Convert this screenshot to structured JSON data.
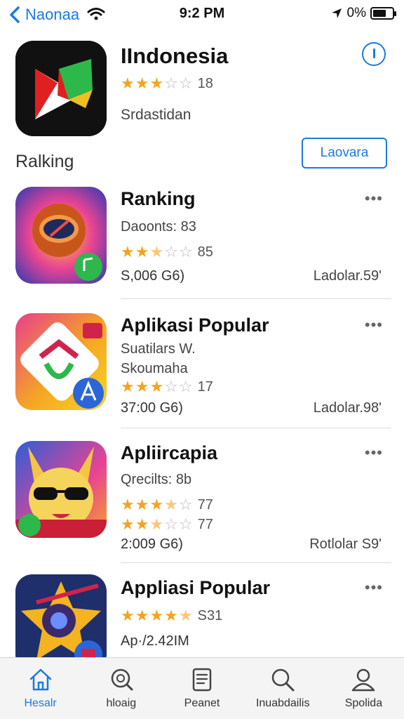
{
  "status_bar": {
    "back_label": "Naonaa",
    "time": "9:2 PM",
    "battery_text": "0%"
  },
  "header": {
    "title": "IIndonesia",
    "rating_count": "18",
    "subtitle": "Srdastidan",
    "section_label": "Ralking",
    "action_button": "Laovara"
  },
  "apps": [
    {
      "title": "Ranking",
      "lines": [
        "Daoonts: 83"
      ],
      "rating_rows": [
        {
          "filled": 2,
          "half": 1,
          "count": "85"
        }
      ],
      "size": "S,006 G6)",
      "right": "Ladolar.59'"
    },
    {
      "title": "Aplikasi Popular",
      "lines": [
        "Suatilars W.",
        "Skoumaha"
      ],
      "rating_rows": [
        {
          "filled": 3,
          "half": 0,
          "count": "17"
        }
      ],
      "size": "37:00 G6)",
      "right": "Ladolar.98'"
    },
    {
      "title": "Apliircapia",
      "lines": [
        "Qrecilts: 8b"
      ],
      "rating_rows": [
        {
          "filled": 3,
          "half": 1,
          "count": "77"
        },
        {
          "filled": 2,
          "half": 1,
          "count": "77"
        }
      ],
      "size": "2:009 G6)",
      "right": "Rotlolar S9'"
    },
    {
      "title": "Appliasi Popular",
      "lines": [],
      "rating_rows": [
        {
          "filled": 4,
          "half": 1,
          "count": "S31"
        }
      ],
      "size": "Ap·/2.42IM",
      "right": ""
    }
  ],
  "tabs": [
    {
      "label": "Hesalr",
      "icon": "home-icon"
    },
    {
      "label": "hloaig",
      "icon": "search-globe-icon"
    },
    {
      "label": "Peanet",
      "icon": "document-icon"
    },
    {
      "label": "Inuabdailis",
      "icon": "search-icon"
    },
    {
      "label": "Spolida",
      "icon": "person-icon"
    }
  ],
  "colors": {
    "accent": "#1a7ae0",
    "star": "#f4a321"
  }
}
